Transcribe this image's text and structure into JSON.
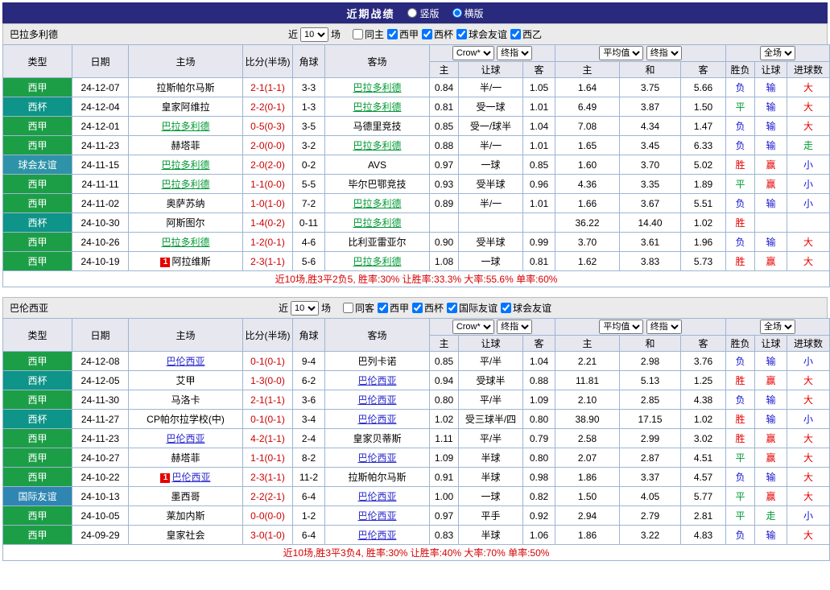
{
  "topbar": {
    "title": "近期战绩",
    "options": [
      {
        "label": "竖版",
        "selected": false
      },
      {
        "label": "横版",
        "selected": true
      }
    ]
  },
  "filter_labels": {
    "near": "近",
    "count": "10",
    "games": "场"
  },
  "table_header": {
    "type": "类型",
    "date": "日期",
    "home": "主场",
    "score": "比分(半场)",
    "corner": "角球",
    "away": "客场",
    "ah_home": "主",
    "ah_line": "让球",
    "ah_away": "客",
    "eu_home": "主",
    "eu_draw": "和",
    "eu_away": "客",
    "result": "胜负",
    "ah_result": "让球",
    "goals": "进球数",
    "bookmaker": "Crow*",
    "final_odds_1": "终指",
    "average": "平均值",
    "final_odds_2": "终指",
    "fulltime": "全场"
  },
  "colors": {
    "topbar_bg": "#29297e",
    "league": {
      "西甲": "#1c9e46",
      "西杯": "#0e9488",
      "球会友谊": "#2e93a8",
      "国际友谊": "#2f86b3"
    },
    "win_red": "#e60000",
    "lose_blue": "#1515d0",
    "draw_green": "#009933",
    "score_red": "#cc0000",
    "summary_red": "#d60000"
  },
  "red_card_badge": "1",
  "sections": [
    {
      "team": "巴拉多利德",
      "focal_color": "#009933",
      "filters": [
        {
          "label": "同主",
          "checked": false
        },
        {
          "label": "西甲",
          "checked": true
        },
        {
          "label": "西杯",
          "checked": true
        },
        {
          "label": "球会友谊",
          "checked": true
        },
        {
          "label": "西乙",
          "checked": true
        }
      ],
      "rows": [
        {
          "type": "西甲",
          "date": "24-12-07",
          "home": "拉斯帕尔马斯",
          "score": "2-1(1-1)",
          "corner": "3-3",
          "away": "巴拉多利德",
          "focal": "away",
          "red": "",
          "ah": [
            "0.84",
            "半/一",
            "1.05"
          ],
          "eu": [
            "1.64",
            "3.75",
            "5.66"
          ],
          "res": "负",
          "ahres": "输",
          "oures": "大"
        },
        {
          "type": "西杯",
          "date": "24-12-04",
          "home": "皇家阿维拉",
          "score": "2-2(0-1)",
          "corner": "1-3",
          "away": "巴拉多利德",
          "focal": "away",
          "red": "",
          "ah": [
            "0.81",
            "受一球",
            "1.01"
          ],
          "eu": [
            "6.49",
            "3.87",
            "1.50"
          ],
          "res": "平",
          "ahres": "输",
          "oures": "大"
        },
        {
          "type": "西甲",
          "date": "24-12-01",
          "home": "巴拉多利德",
          "score": "0-5(0-3)",
          "corner": "3-5",
          "away": "马德里竞技",
          "focal": "home",
          "red": "",
          "ah": [
            "0.85",
            "受一/球半",
            "1.04"
          ],
          "eu": [
            "7.08",
            "4.34",
            "1.47"
          ],
          "res": "负",
          "ahres": "输",
          "oures": "大"
        },
        {
          "type": "西甲",
          "date": "24-11-23",
          "home": "赫塔菲",
          "score": "2-0(0-0)",
          "corner": "3-2",
          "away": "巴拉多利德",
          "focal": "away",
          "red": "",
          "ah": [
            "0.88",
            "半/一",
            "1.01"
          ],
          "eu": [
            "1.65",
            "3.45",
            "6.33"
          ],
          "res": "负",
          "ahres": "输",
          "oures": "走"
        },
        {
          "type": "球会友谊",
          "date": "24-11-15",
          "home": "巴拉多利德",
          "score": "2-0(2-0)",
          "corner": "0-2",
          "away": "AVS",
          "focal": "home",
          "red": "",
          "ah": [
            "0.97",
            "一球",
            "0.85"
          ],
          "eu": [
            "1.60",
            "3.70",
            "5.02"
          ],
          "res": "胜",
          "ahres": "赢",
          "oures": "小"
        },
        {
          "type": "西甲",
          "date": "24-11-11",
          "home": "巴拉多利德",
          "score": "1-1(0-0)",
          "corner": "5-5",
          "away": "毕尔巴鄂竞技",
          "focal": "home",
          "red": "",
          "ah": [
            "0.93",
            "受半球",
            "0.96"
          ],
          "eu": [
            "4.36",
            "3.35",
            "1.89"
          ],
          "res": "平",
          "ahres": "赢",
          "oures": "小"
        },
        {
          "type": "西甲",
          "date": "24-11-02",
          "home": "奥萨苏纳",
          "score": "1-0(1-0)",
          "corner": "7-2",
          "away": "巴拉多利德",
          "focal": "away",
          "red": "",
          "ah": [
            "0.89",
            "半/一",
            "1.01"
          ],
          "eu": [
            "1.66",
            "3.67",
            "5.51"
          ],
          "res": "负",
          "ahres": "输",
          "oures": "小"
        },
        {
          "type": "西杯",
          "date": "24-10-30",
          "home": "阿斯图尔",
          "score": "1-4(0-2)",
          "corner": "0-11",
          "away": "巴拉多利德",
          "focal": "away",
          "red": "",
          "ah": [
            "",
            "",
            ""
          ],
          "eu": [
            "36.22",
            "14.40",
            "1.02"
          ],
          "res": "胜",
          "ahres": "",
          "oures": ""
        },
        {
          "type": "西甲",
          "date": "24-10-26",
          "home": "巴拉多利德",
          "score": "1-2(0-1)",
          "corner": "4-6",
          "away": "比利亚雷亚尔",
          "focal": "home",
          "red": "",
          "ah": [
            "0.90",
            "受半球",
            "0.99"
          ],
          "eu": [
            "3.70",
            "3.61",
            "1.96"
          ],
          "res": "负",
          "ahres": "输",
          "oures": "大"
        },
        {
          "type": "西甲",
          "date": "24-10-19",
          "home": "阿拉维斯",
          "score": "2-3(1-1)",
          "corner": "5-6",
          "away": "巴拉多利德",
          "focal": "away",
          "red": "home",
          "ah": [
            "1.08",
            "一球",
            "0.81"
          ],
          "eu": [
            "1.62",
            "3.83",
            "5.73"
          ],
          "res": "胜",
          "ahres": "赢",
          "oures": "大"
        }
      ],
      "summary": "近10场,胜3平2负5, 胜率:30% 让胜率:33.3% 大率:55.6% 单率:60%"
    },
    {
      "team": "巴伦西亚",
      "focal_color": "#2626cc",
      "filters": [
        {
          "label": "同客",
          "checked": false
        },
        {
          "label": "西甲",
          "checked": true
        },
        {
          "label": "西杯",
          "checked": true
        },
        {
          "label": "国际友谊",
          "checked": true
        },
        {
          "label": "球会友谊",
          "checked": true
        }
      ],
      "rows": [
        {
          "type": "西甲",
          "date": "24-12-08",
          "home": "巴伦西亚",
          "score": "0-1(0-1)",
          "corner": "9-4",
          "away": "巴列卡诺",
          "focal": "home",
          "red": "",
          "ah": [
            "0.85",
            "平/半",
            "1.04"
          ],
          "eu": [
            "2.21",
            "2.98",
            "3.76"
          ],
          "res": "负",
          "ahres": "输",
          "oures": "小"
        },
        {
          "type": "西杯",
          "date": "24-12-05",
          "home": "艾甲",
          "score": "1-3(0-0)",
          "corner": "6-2",
          "away": "巴伦西亚",
          "focal": "away",
          "red": "",
          "ah": [
            "0.94",
            "受球半",
            "0.88"
          ],
          "eu": [
            "11.81",
            "5.13",
            "1.25"
          ],
          "res": "胜",
          "ahres": "赢",
          "oures": "大"
        },
        {
          "type": "西甲",
          "date": "24-11-30",
          "home": "马洛卡",
          "score": "2-1(1-1)",
          "corner": "3-6",
          "away": "巴伦西亚",
          "focal": "away",
          "red": "",
          "ah": [
            "0.80",
            "平/半",
            "1.09"
          ],
          "eu": [
            "2.10",
            "2.85",
            "4.38"
          ],
          "res": "负",
          "ahres": "输",
          "oures": "大"
        },
        {
          "type": "西杯",
          "date": "24-11-27",
          "home": "CP帕尔拉学校(中)",
          "score": "0-1(0-1)",
          "corner": "3-4",
          "away": "巴伦西亚",
          "focal": "away",
          "red": "",
          "ah": [
            "1.02",
            "受三球半/四",
            "0.80"
          ],
          "eu": [
            "38.90",
            "17.15",
            "1.02"
          ],
          "res": "胜",
          "ahres": "输",
          "oures": "小"
        },
        {
          "type": "西甲",
          "date": "24-11-23",
          "home": "巴伦西亚",
          "score": "4-2(1-1)",
          "corner": "2-4",
          "away": "皇家贝蒂斯",
          "focal": "home",
          "red": "",
          "ah": [
            "1.11",
            "平/半",
            "0.79"
          ],
          "eu": [
            "2.58",
            "2.99",
            "3.02"
          ],
          "res": "胜",
          "ahres": "赢",
          "oures": "大"
        },
        {
          "type": "西甲",
          "date": "24-10-27",
          "home": "赫塔菲",
          "score": "1-1(0-1)",
          "corner": "8-2",
          "away": "巴伦西亚",
          "focal": "away",
          "red": "",
          "ah": [
            "1.09",
            "半球",
            "0.80"
          ],
          "eu": [
            "2.07",
            "2.87",
            "4.51"
          ],
          "res": "平",
          "ahres": "赢",
          "oures": "大"
        },
        {
          "type": "西甲",
          "date": "24-10-22",
          "home": "巴伦西亚",
          "score": "2-3(1-1)",
          "corner": "11-2",
          "away": "拉斯帕尔马斯",
          "focal": "home",
          "red": "home",
          "ah": [
            "0.91",
            "半球",
            "0.98"
          ],
          "eu": [
            "1.86",
            "3.37",
            "4.57"
          ],
          "res": "负",
          "ahres": "输",
          "oures": "大"
        },
        {
          "type": "国际友谊",
          "date": "24-10-13",
          "home": "墨西哥",
          "score": "2-2(2-1)",
          "corner": "6-4",
          "away": "巴伦西亚",
          "focal": "away",
          "red": "",
          "ah": [
            "1.00",
            "一球",
            "0.82"
          ],
          "eu": [
            "1.50",
            "4.05",
            "5.77"
          ],
          "res": "平",
          "ahres": "赢",
          "oures": "大"
        },
        {
          "type": "西甲",
          "date": "24-10-05",
          "home": "莱加内斯",
          "score": "0-0(0-0)",
          "corner": "1-2",
          "away": "巴伦西亚",
          "focal": "away",
          "red": "",
          "ah": [
            "0.97",
            "平手",
            "0.92"
          ],
          "eu": [
            "2.94",
            "2.79",
            "2.81"
          ],
          "res": "平",
          "ahres": "走",
          "oures": "小"
        },
        {
          "type": "西甲",
          "date": "24-09-29",
          "home": "皇家社会",
          "score": "3-0(1-0)",
          "corner": "6-4",
          "away": "巴伦西亚",
          "focal": "away",
          "red": "",
          "ah": [
            "0.83",
            "半球",
            "1.06"
          ],
          "eu": [
            "1.86",
            "3.22",
            "4.83"
          ],
          "res": "负",
          "ahres": "输",
          "oures": "大"
        }
      ],
      "summary": "近10场,胜3平3负4, 胜率:30% 让胜率:40% 大率:70% 单率:50%"
    }
  ]
}
